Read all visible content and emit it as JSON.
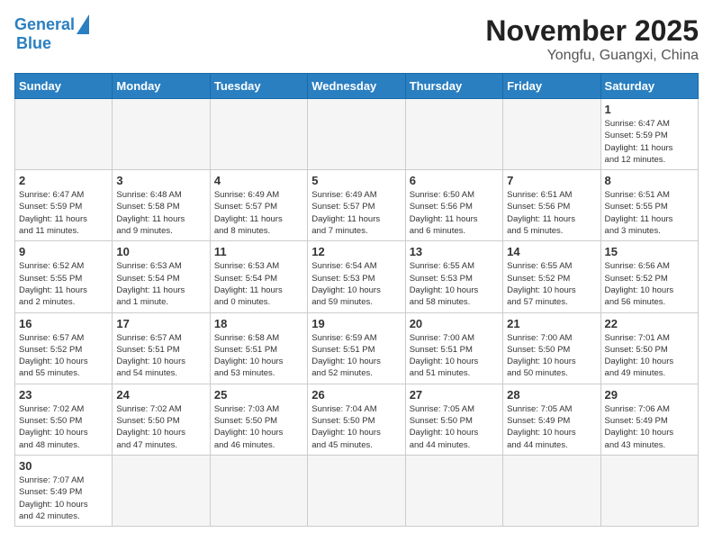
{
  "header": {
    "logo_general": "General",
    "logo_blue": "Blue",
    "title": "November 2025",
    "subtitle": "Yongfu, Guangxi, China"
  },
  "weekdays": [
    "Sunday",
    "Monday",
    "Tuesday",
    "Wednesday",
    "Thursday",
    "Friday",
    "Saturday"
  ],
  "days": [
    {
      "num": "",
      "info": ""
    },
    {
      "num": "",
      "info": ""
    },
    {
      "num": "",
      "info": ""
    },
    {
      "num": "",
      "info": ""
    },
    {
      "num": "",
      "info": ""
    },
    {
      "num": "",
      "info": ""
    },
    {
      "num": "1",
      "info": "Sunrise: 6:47 AM\nSunset: 5:59 PM\nDaylight: 11 hours\nand 12 minutes."
    },
    {
      "num": "2",
      "info": "Sunrise: 6:47 AM\nSunset: 5:59 PM\nDaylight: 11 hours\nand 11 minutes."
    },
    {
      "num": "3",
      "info": "Sunrise: 6:48 AM\nSunset: 5:58 PM\nDaylight: 11 hours\nand 9 minutes."
    },
    {
      "num": "4",
      "info": "Sunrise: 6:49 AM\nSunset: 5:57 PM\nDaylight: 11 hours\nand 8 minutes."
    },
    {
      "num": "5",
      "info": "Sunrise: 6:49 AM\nSunset: 5:57 PM\nDaylight: 11 hours\nand 7 minutes."
    },
    {
      "num": "6",
      "info": "Sunrise: 6:50 AM\nSunset: 5:56 PM\nDaylight: 11 hours\nand 6 minutes."
    },
    {
      "num": "7",
      "info": "Sunrise: 6:51 AM\nSunset: 5:56 PM\nDaylight: 11 hours\nand 5 minutes."
    },
    {
      "num": "8",
      "info": "Sunrise: 6:51 AM\nSunset: 5:55 PM\nDaylight: 11 hours\nand 3 minutes."
    },
    {
      "num": "9",
      "info": "Sunrise: 6:52 AM\nSunset: 5:55 PM\nDaylight: 11 hours\nand 2 minutes."
    },
    {
      "num": "10",
      "info": "Sunrise: 6:53 AM\nSunset: 5:54 PM\nDaylight: 11 hours\nand 1 minute."
    },
    {
      "num": "11",
      "info": "Sunrise: 6:53 AM\nSunset: 5:54 PM\nDaylight: 11 hours\nand 0 minutes."
    },
    {
      "num": "12",
      "info": "Sunrise: 6:54 AM\nSunset: 5:53 PM\nDaylight: 10 hours\nand 59 minutes."
    },
    {
      "num": "13",
      "info": "Sunrise: 6:55 AM\nSunset: 5:53 PM\nDaylight: 10 hours\nand 58 minutes."
    },
    {
      "num": "14",
      "info": "Sunrise: 6:55 AM\nSunset: 5:52 PM\nDaylight: 10 hours\nand 57 minutes."
    },
    {
      "num": "15",
      "info": "Sunrise: 6:56 AM\nSunset: 5:52 PM\nDaylight: 10 hours\nand 56 minutes."
    },
    {
      "num": "16",
      "info": "Sunrise: 6:57 AM\nSunset: 5:52 PM\nDaylight: 10 hours\nand 55 minutes."
    },
    {
      "num": "17",
      "info": "Sunrise: 6:57 AM\nSunset: 5:51 PM\nDaylight: 10 hours\nand 54 minutes."
    },
    {
      "num": "18",
      "info": "Sunrise: 6:58 AM\nSunset: 5:51 PM\nDaylight: 10 hours\nand 53 minutes."
    },
    {
      "num": "19",
      "info": "Sunrise: 6:59 AM\nSunset: 5:51 PM\nDaylight: 10 hours\nand 52 minutes."
    },
    {
      "num": "20",
      "info": "Sunrise: 7:00 AM\nSunset: 5:51 PM\nDaylight: 10 hours\nand 51 minutes."
    },
    {
      "num": "21",
      "info": "Sunrise: 7:00 AM\nSunset: 5:50 PM\nDaylight: 10 hours\nand 50 minutes."
    },
    {
      "num": "22",
      "info": "Sunrise: 7:01 AM\nSunset: 5:50 PM\nDaylight: 10 hours\nand 49 minutes."
    },
    {
      "num": "23",
      "info": "Sunrise: 7:02 AM\nSunset: 5:50 PM\nDaylight: 10 hours\nand 48 minutes."
    },
    {
      "num": "24",
      "info": "Sunrise: 7:02 AM\nSunset: 5:50 PM\nDaylight: 10 hours\nand 47 minutes."
    },
    {
      "num": "25",
      "info": "Sunrise: 7:03 AM\nSunset: 5:50 PM\nDaylight: 10 hours\nand 46 minutes."
    },
    {
      "num": "26",
      "info": "Sunrise: 7:04 AM\nSunset: 5:50 PM\nDaylight: 10 hours\nand 45 minutes."
    },
    {
      "num": "27",
      "info": "Sunrise: 7:05 AM\nSunset: 5:50 PM\nDaylight: 10 hours\nand 44 minutes."
    },
    {
      "num": "28",
      "info": "Sunrise: 7:05 AM\nSunset: 5:49 PM\nDaylight: 10 hours\nand 44 minutes."
    },
    {
      "num": "29",
      "info": "Sunrise: 7:06 AM\nSunset: 5:49 PM\nDaylight: 10 hours\nand 43 minutes."
    },
    {
      "num": "30",
      "info": "Sunrise: 7:07 AM\nSunset: 5:49 PM\nDaylight: 10 hours\nand 42 minutes."
    },
    {
      "num": "",
      "info": ""
    },
    {
      "num": "",
      "info": ""
    },
    {
      "num": "",
      "info": ""
    },
    {
      "num": "",
      "info": ""
    },
    {
      "num": "",
      "info": ""
    },
    {
      "num": "",
      "info": ""
    }
  ]
}
